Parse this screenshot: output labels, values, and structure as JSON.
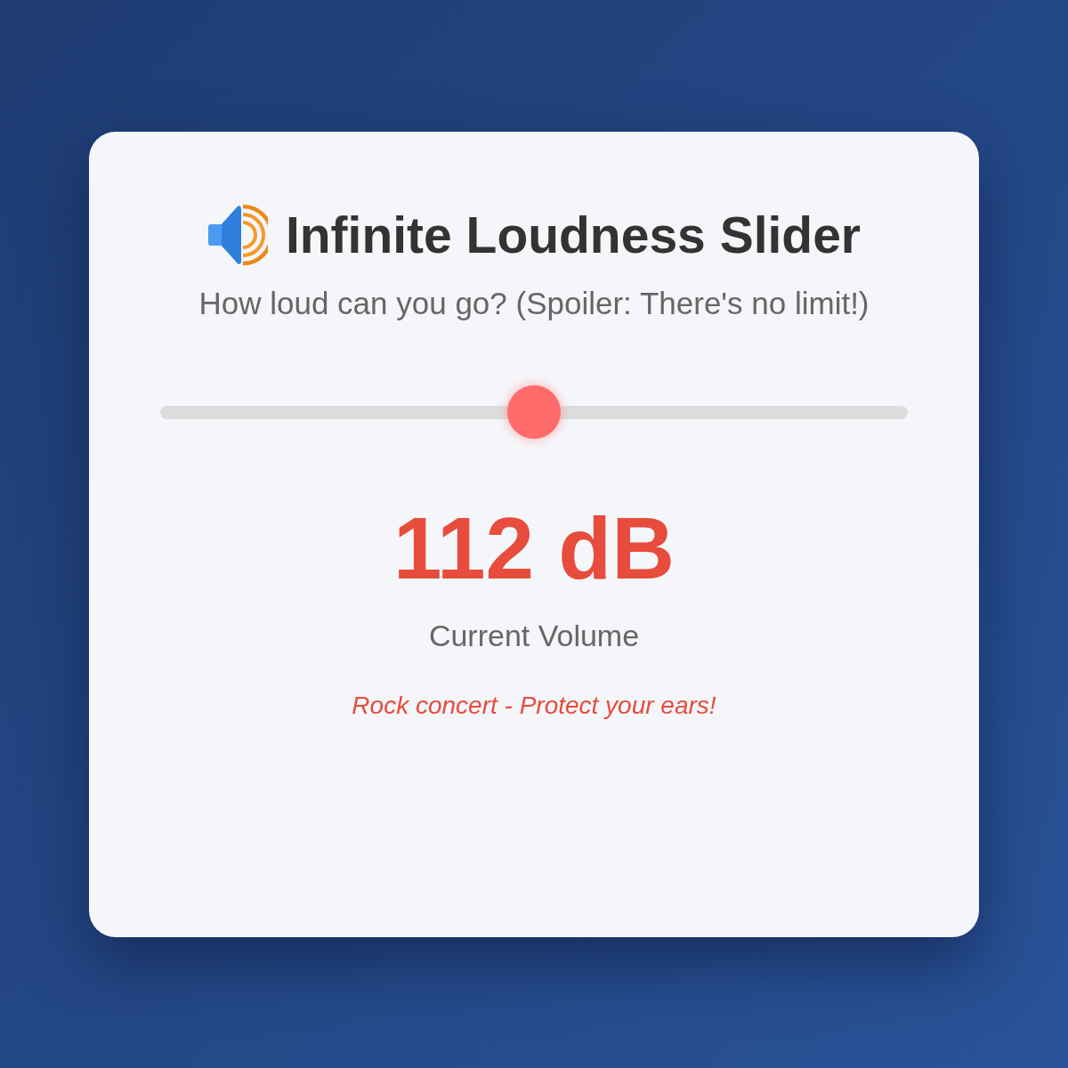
{
  "title": "Infinite Loudness Slider",
  "subtitle": "How loud can you go? (Spoiler: There's no limit!)",
  "slider": {
    "level": 0.5
  },
  "reading": "112 dB",
  "reading_label": "Current Volume",
  "warning": "Rock concert - Protect your ears!"
}
